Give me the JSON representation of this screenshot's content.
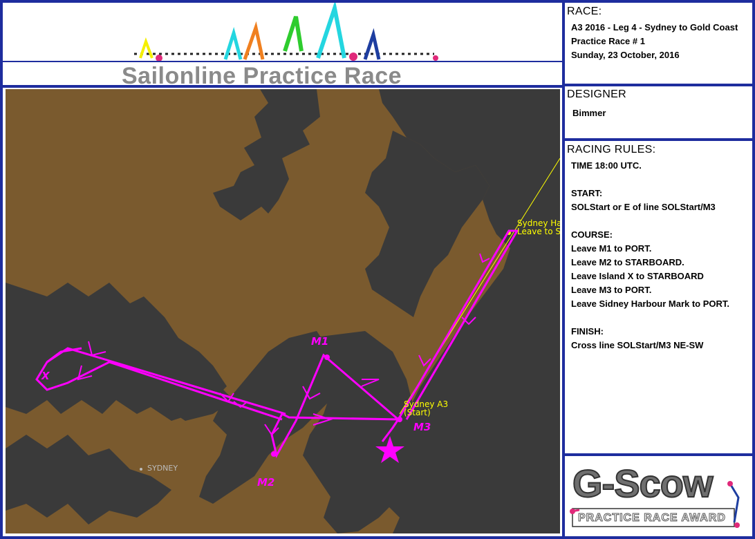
{
  "header": {
    "title": "Sailonline Practice Race"
  },
  "race": {
    "heading": "RACE:",
    "lines": [
      "A3 2016 - Leg 4 - Sydney to Gold Coast",
      "Practice Race # 1",
      "Sunday, 23 October, 2016"
    ]
  },
  "designer": {
    "heading": "DESIGNER",
    "name": "Bimmer"
  },
  "rules": {
    "heading": "RACING RULES:",
    "lines": [
      "TIME 18:00 UTC.",
      "",
      "START:",
      "SOLStart or E of line SOLStart/M3",
      "",
      "COURSE:",
      "Leave M1 to PORT.",
      "Leave M2 to STARBOARD.",
      "Leave Island X to STARBOARD",
      "Leave M3 to PORT.",
      "Leave Sidney Harbour Mark to PORT.",
      "",
      "FINISH:",
      "Cross line SOLStart/M3 NE-SW"
    ]
  },
  "map": {
    "labels": {
      "harbour_line1": "Sydney Ha",
      "harbour_line2": "Leave to S",
      "start_line1": "Sydney A3",
      "start_line2": "(Start)",
      "city": "SYDNEY",
      "m1": "M1",
      "m2": "M2",
      "m3": "M3",
      "x": "X"
    },
    "colors": {
      "water": "#7a5a2e",
      "land": "#3a3a3a",
      "course": "#ff00ff",
      "mark": "#ffff00"
    }
  },
  "award": {
    "title": "G-Scow",
    "subtitle": "PRACTICE RACE AWARD"
  },
  "colors": {
    "frame": "#1e2d9e"
  }
}
